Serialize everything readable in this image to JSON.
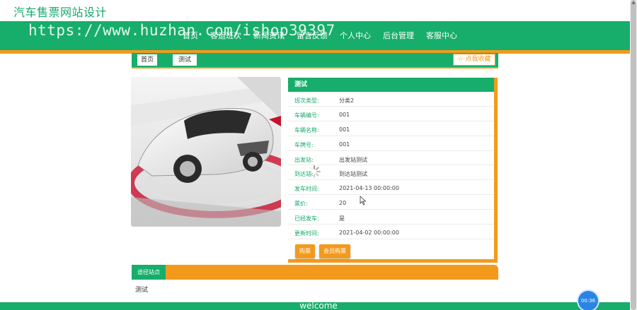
{
  "header": {
    "site_title": "汽车售票网站设计",
    "nav": [
      "首页",
      "客运班次",
      "新闻资讯",
      "留言反馈",
      "个人中心",
      "后台管理",
      "客服中心"
    ],
    "watermark": "https://www.huzhan.com/ishop39397"
  },
  "breadcrumb": {
    "home": "首页",
    "current": "测试",
    "favorite": "☆ 点我收藏"
  },
  "detail": {
    "title": "测试",
    "rows": [
      {
        "label": "班次类型:",
        "value": "分类2"
      },
      {
        "label": "车辆编号:",
        "value": "001"
      },
      {
        "label": "车辆名称:",
        "value": "001"
      },
      {
        "label": "车牌号:",
        "value": "001"
      },
      {
        "label": "出发站:",
        "value": "出发站测试"
      },
      {
        "label": "到达站:",
        "value": "到达站测试"
      },
      {
        "label": "发车时间:",
        "value": "2021-04-13 00:00:00"
      },
      {
        "label": "票价:",
        "value": "20"
      },
      {
        "label": "已经发车:",
        "value": "是"
      },
      {
        "label": "更新时间:",
        "value": "2021-04-02 00:00:00"
      }
    ],
    "buy_button": "购票",
    "member_buy_button": "会员购票"
  },
  "section": {
    "tab_label": "途径站点",
    "content": "测试"
  },
  "footer": {
    "text": "welcome"
  },
  "timer_badge": "00:36",
  "colors": {
    "green": "#16ae6a",
    "orange": "#f39a1c"
  }
}
